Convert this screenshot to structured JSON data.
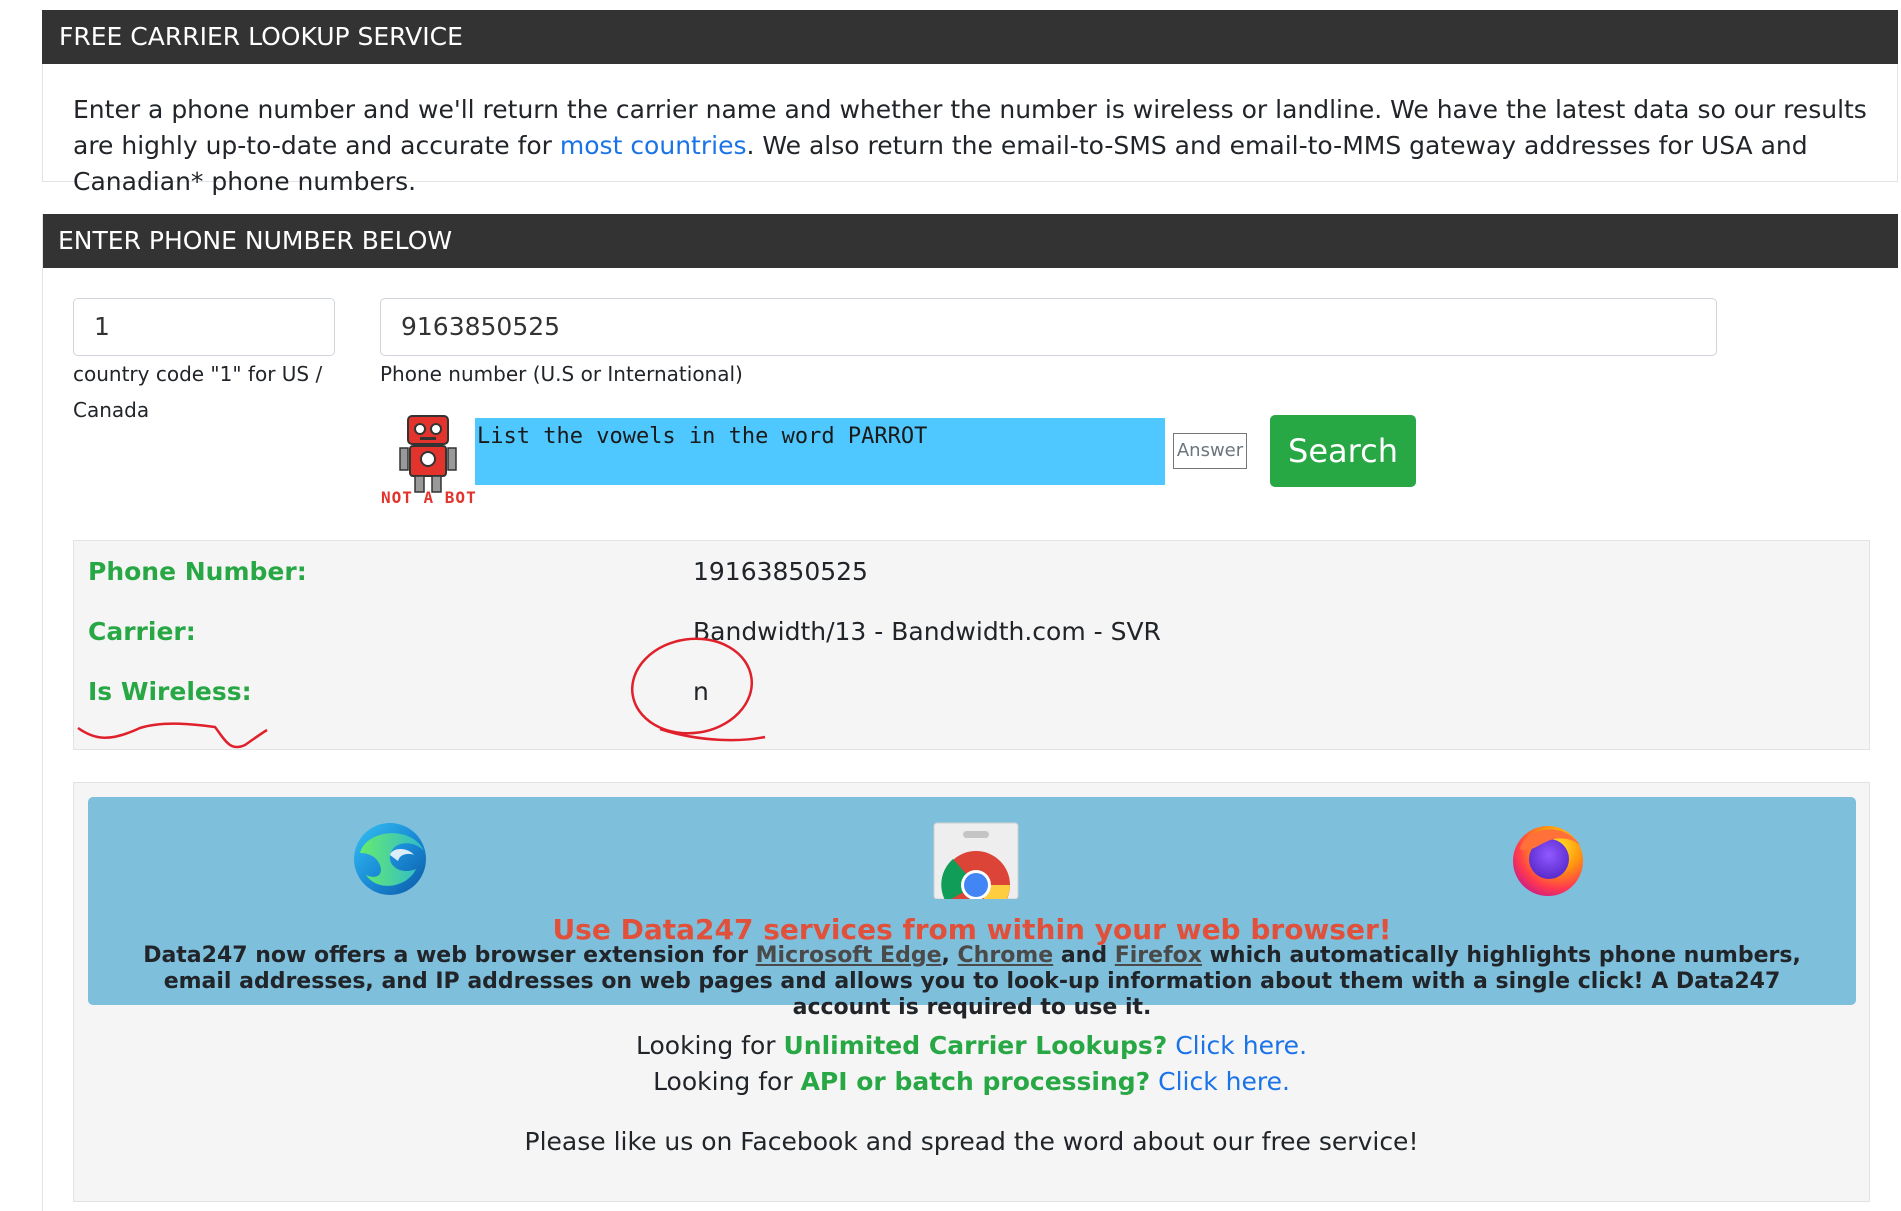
{
  "intro": {
    "header": "FREE CARRIER LOOKUP SERVICE",
    "text_before_link": "Enter a phone number and we'll return the carrier name and whether the number is wireless or landline. We have the latest data so our results are highly up-to-date and accurate for ",
    "link": "most countries",
    "text_after_link": ". We also return the email-to-SMS and email-to-MMS gateway addresses for USA and Canadian* phone numbers."
  },
  "form": {
    "header": "ENTER PHONE NUMBER BELOW",
    "country_code_value": "1",
    "country_code_help_1": "country code \"1\" for US /",
    "country_code_help_2": "Canada",
    "phone_value": "9163850525",
    "phone_help": "Phone number (U.S or International)",
    "captcha_badge": "NOT A BOT",
    "captcha_question": "List the vowels in the word PARROT",
    "answer_placeholder": "Answer",
    "search_label": "Search"
  },
  "result": {
    "rows": [
      {
        "label": "Phone Number:",
        "value": "19163850525"
      },
      {
        "label": "Carrier:",
        "value": "Bandwidth/13 - Bandwidth.com - SVR"
      },
      {
        "label": "Is Wireless:",
        "value": "n"
      }
    ]
  },
  "promo": {
    "title": "Use Data247 services from within your web browser!",
    "text_1": "Data247 now offers a web browser extension for ",
    "edge": "Microsoft Edge",
    "sep": ", ",
    "chrome": "Chrome",
    "and": " and ",
    "firefox": "Firefox",
    "text_2": " which automatically highlights phone numbers, email addresses, and IP addresses on web pages and allows you to look-up information about them with a single click! A Data247 account is required to use it."
  },
  "footer": {
    "line1_prefix": "Looking for ",
    "line1_bold": "Unlimited Carrier Lookups?",
    "line1_link": " Click here.",
    "line2_prefix": "Looking for ",
    "line2_bold": "API or batch processing?",
    "line2_link": " Click here.",
    "line3": "Please like us on Facebook and spread the word about our free service!"
  },
  "icons": [
    "edge-icon",
    "chrome-webstore-icon",
    "firefox-icon",
    "robot-icon"
  ],
  "colors": {
    "header_bg": "#333333",
    "green": "#28a745",
    "link": "#1a73e8",
    "promo_bg": "#7ebfdc",
    "promo_title": "#e0503a",
    "annotation": "#e0202a"
  }
}
